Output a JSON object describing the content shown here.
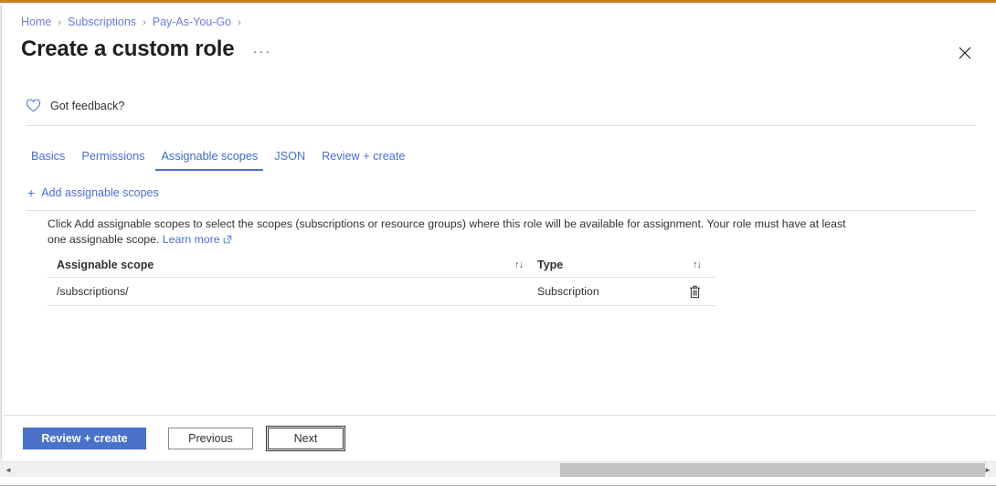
{
  "window": {
    "accent_top_border": "#c8801d",
    "close_label": "Close",
    "brand_blue": "#4a6fd4"
  },
  "breadcrumb": {
    "items": [
      {
        "label": "Home"
      },
      {
        "label": "Subscriptions"
      },
      {
        "label": "Pay-As-You-Go"
      }
    ],
    "separator": "›"
  },
  "header": {
    "title": "Create a custom role",
    "more_label": "···"
  },
  "feedback": {
    "label": "Got feedback?",
    "icon": "heart-icon"
  },
  "tabs": [
    {
      "label": "Basics",
      "active": false
    },
    {
      "label": "Permissions",
      "active": false
    },
    {
      "label": "Assignable scopes",
      "active": true
    },
    {
      "label": "JSON",
      "active": false
    },
    {
      "label": "Review + create",
      "active": false
    }
  ],
  "command_bar": {
    "add_scopes_label": "Add assignable scopes",
    "plus_glyph": "+"
  },
  "description": {
    "text": "Click Add assignable scopes to select the scopes (subscriptions or resource groups) where this role will be available for assignment. Your role must have at least one assignable scope.",
    "learn_more_label": "Learn more"
  },
  "table": {
    "columns": [
      {
        "label": "Assignable scope",
        "sortable": true
      },
      {
        "label": "Type",
        "sortable": true
      }
    ],
    "sort_glyph": "↑↓",
    "rows": [
      {
        "scope": "/subscriptions/",
        "type": "Subscription",
        "delete_label": "Delete"
      }
    ]
  },
  "footer": {
    "buttons": [
      {
        "label": "Review + create",
        "style": "primary"
      },
      {
        "label": "Previous",
        "style": "secondary"
      },
      {
        "label": "Next",
        "style": "focused"
      }
    ]
  },
  "scrollbar": {
    "left_arrow": "◄",
    "right_arrow": "►"
  }
}
